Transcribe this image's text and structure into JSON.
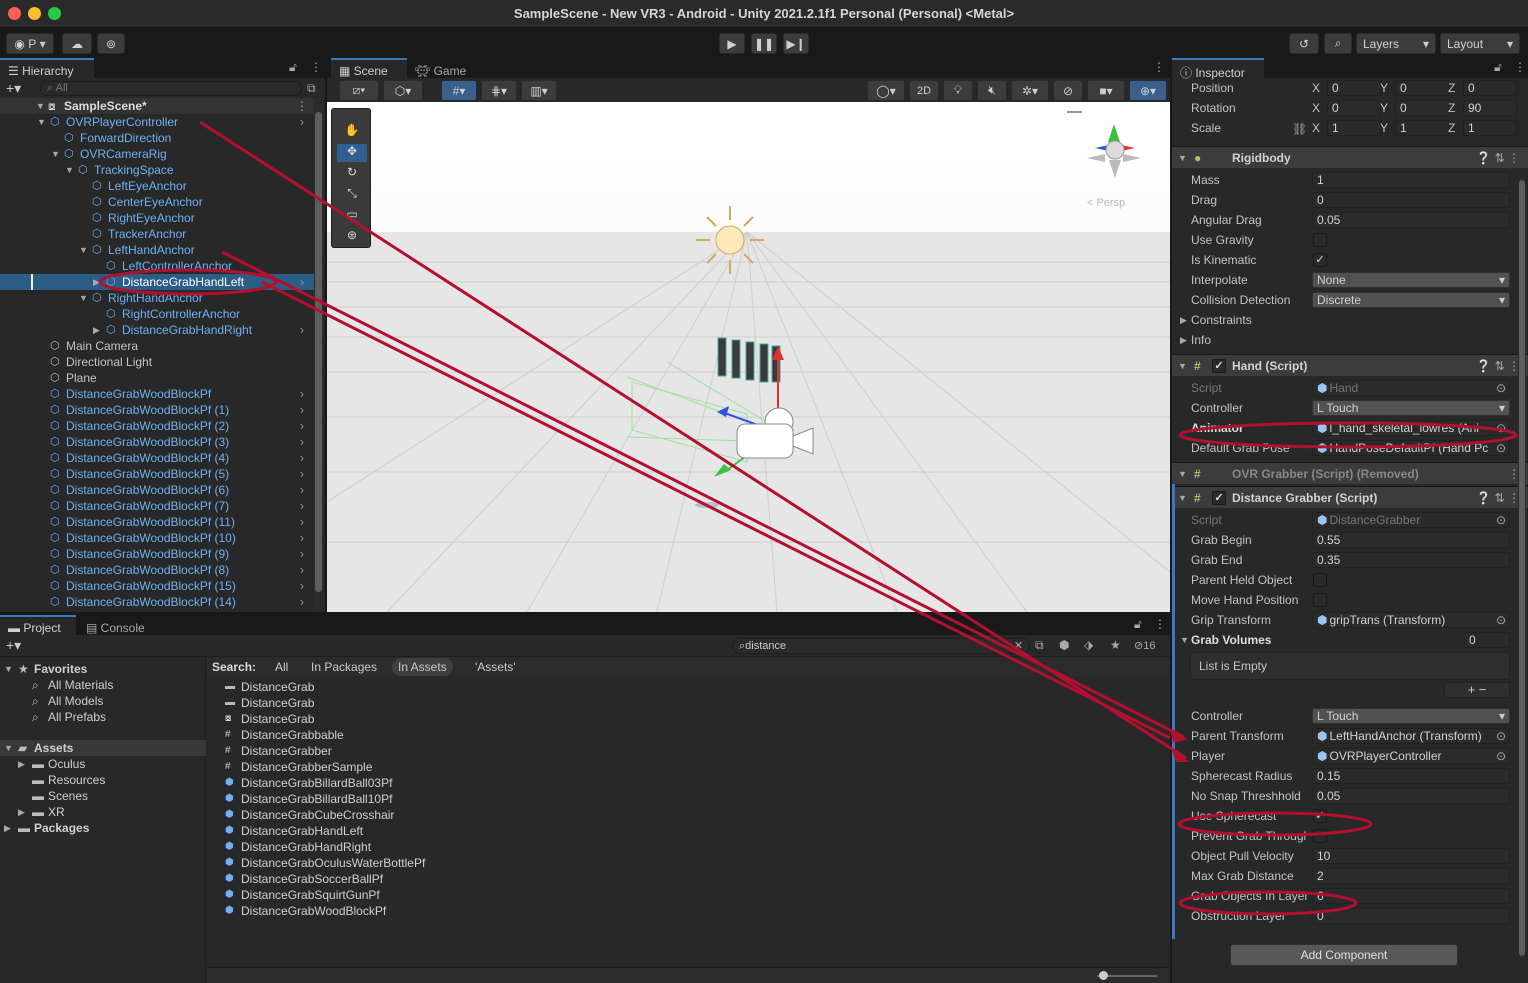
{
  "window": {
    "title": "SampleScene - New VR3 - Android - Unity 2021.2.1f1 Personal (Personal) <Metal>"
  },
  "toolbar": {
    "account": "P",
    "layers": "Layers",
    "layout": "Layout"
  },
  "hierarchy": {
    "tab": "Hierarchy",
    "search_placeholder": "All",
    "scene": "SampleScene*",
    "items": [
      {
        "label": "OVRPlayerController",
        "blue": true,
        "depth": 1,
        "fold": "open",
        "arrow": true
      },
      {
        "label": "ForwardDirection",
        "blue": true,
        "depth": 2
      },
      {
        "label": "OVRCameraRig",
        "blue": true,
        "depth": 2,
        "fold": "open"
      },
      {
        "label": "TrackingSpace",
        "blue": true,
        "depth": 3,
        "fold": "open"
      },
      {
        "label": "LeftEyeAnchor",
        "blue": true,
        "depth": 4
      },
      {
        "label": "CenterEyeAnchor",
        "blue": true,
        "depth": 4
      },
      {
        "label": "RightEyeAnchor",
        "blue": true,
        "depth": 4
      },
      {
        "label": "TrackerAnchor",
        "blue": true,
        "depth": 4
      },
      {
        "label": "LeftHandAnchor",
        "blue": true,
        "depth": 4,
        "fold": "open"
      },
      {
        "label": "LeftControllerAnchor",
        "blue": true,
        "depth": 5
      },
      {
        "label": "DistanceGrabHandLeft",
        "blue": true,
        "depth": 5,
        "fold": "closed",
        "selected": true,
        "arrow": true
      },
      {
        "label": "RightHandAnchor",
        "blue": true,
        "depth": 4,
        "fold": "open"
      },
      {
        "label": "RightControllerAnchor",
        "blue": true,
        "depth": 5
      },
      {
        "label": "DistanceGrabHandRight",
        "blue": true,
        "depth": 5,
        "fold": "closed",
        "arrow": true
      },
      {
        "label": "Main Camera",
        "blue": false,
        "depth": 1
      },
      {
        "label": "Directional Light",
        "blue": false,
        "depth": 1
      },
      {
        "label": "Plane",
        "blue": false,
        "depth": 1
      },
      {
        "label": "DistanceGrabWoodBlockPf",
        "blue": true,
        "depth": 1,
        "arrow": true
      },
      {
        "label": "DistanceGrabWoodBlockPf (1)",
        "blue": true,
        "depth": 1,
        "arrow": true
      },
      {
        "label": "DistanceGrabWoodBlockPf (2)",
        "blue": true,
        "depth": 1,
        "arrow": true
      },
      {
        "label": "DistanceGrabWoodBlockPf (3)",
        "blue": true,
        "depth": 1,
        "arrow": true
      },
      {
        "label": "DistanceGrabWoodBlockPf (4)",
        "blue": true,
        "depth": 1,
        "arrow": true
      },
      {
        "label": "DistanceGrabWoodBlockPf (5)",
        "blue": true,
        "depth": 1,
        "arrow": true
      },
      {
        "label": "DistanceGrabWoodBlockPf (6)",
        "blue": true,
        "depth": 1,
        "arrow": true
      },
      {
        "label": "DistanceGrabWoodBlockPf (7)",
        "blue": true,
        "depth": 1,
        "arrow": true
      },
      {
        "label": "DistanceGrabWoodBlockPf (11)",
        "blue": true,
        "depth": 1,
        "arrow": true
      },
      {
        "label": "DistanceGrabWoodBlockPf (10)",
        "blue": true,
        "depth": 1,
        "arrow": true
      },
      {
        "label": "DistanceGrabWoodBlockPf (9)",
        "blue": true,
        "depth": 1,
        "arrow": true
      },
      {
        "label": "DistanceGrabWoodBlockPf (8)",
        "blue": true,
        "depth": 1,
        "arrow": true
      },
      {
        "label": "DistanceGrabWoodBlockPf (15)",
        "blue": true,
        "depth": 1,
        "arrow": true
      },
      {
        "label": "DistanceGrabWoodBlockPf (14)",
        "blue": true,
        "depth": 1,
        "arrow": true
      }
    ]
  },
  "scene": {
    "tabs": [
      "Scene",
      "Game"
    ],
    "mode_2d": "2D",
    "persp": "< Persp"
  },
  "project": {
    "tabs": [
      "Project",
      "Console"
    ],
    "search_value": "distance",
    "hidden_count": "16",
    "search_label": "Search:",
    "filters": [
      "All",
      "In Packages",
      "In Assets",
      "'Assets'"
    ],
    "favorites": {
      "title": "Favorites",
      "items": [
        "All Materials",
        "All Models",
        "All Prefabs"
      ]
    },
    "assets_tree": {
      "title": "Assets",
      "items": [
        "Oculus",
        "Resources",
        "Scenes",
        "XR"
      ],
      "packages": "Packages"
    },
    "results": [
      {
        "name": "DistanceGrab",
        "icon": "folder"
      },
      {
        "name": "DistanceGrab",
        "icon": "folder"
      },
      {
        "name": "DistanceGrab",
        "icon": "scene"
      },
      {
        "name": "DistanceGrabbable",
        "icon": "script"
      },
      {
        "name": "DistanceGrabber",
        "icon": "script"
      },
      {
        "name": "DistanceGrabberSample",
        "icon": "script"
      },
      {
        "name": "DistanceGrabBillardBall03Pf",
        "icon": "prefab"
      },
      {
        "name": "DistanceGrabBillardBall10Pf",
        "icon": "prefab"
      },
      {
        "name": "DistanceGrabCubeCrosshair",
        "icon": "prefab"
      },
      {
        "name": "DistanceGrabHandLeft",
        "icon": "prefab"
      },
      {
        "name": "DistanceGrabHandRight",
        "icon": "prefab"
      },
      {
        "name": "DistanceGrabOculusWaterBottlePf",
        "icon": "prefab"
      },
      {
        "name": "DistanceGrabSoccerBallPf",
        "icon": "prefab"
      },
      {
        "name": "DistanceGrabSquirtGunPf",
        "icon": "prefab"
      },
      {
        "name": "DistanceGrabWoodBlockPf",
        "icon": "prefab"
      }
    ]
  },
  "inspector": {
    "tab": "Inspector",
    "transform": {
      "position": {
        "label": "Position",
        "x": "0",
        "y": "0",
        "z": "0"
      },
      "rotation": {
        "label": "Rotation",
        "x": "0",
        "y": "0",
        "z": "90"
      },
      "scale": {
        "label": "Scale",
        "x": "1",
        "y": "1",
        "z": "1"
      }
    },
    "rigidbody": {
      "title": "Rigidbody",
      "rows": [
        {
          "k": "Mass",
          "v": "1"
        },
        {
          "k": "Drag",
          "v": "0"
        },
        {
          "k": "Angular Drag",
          "v": "0.05"
        },
        {
          "k": "Use Gravity",
          "check": false
        },
        {
          "k": "Is Kinematic",
          "check": true
        },
        {
          "k": "Interpolate",
          "v": "None",
          "dropdown": true
        },
        {
          "k": "Collision Detection",
          "v": "Discrete",
          "dropdown": true
        },
        {
          "k": "Constraints",
          "fold": true
        },
        {
          "k": "Info",
          "fold": true
        }
      ]
    },
    "hand": {
      "title": "Hand (Script)",
      "rows": [
        {
          "k": "Script",
          "v": "Hand",
          "disabled": true,
          "obj": true
        },
        {
          "k": "Controller",
          "v": "L Touch",
          "dropdown": true
        },
        {
          "k": "Animator",
          "v": "l_hand_skeletal_lowres (Ani",
          "obj": true,
          "bold": true
        },
        {
          "k": "Default Grab Pose",
          "v": "HandPoseDefaultPf (Hand Pc",
          "obj": true
        }
      ]
    },
    "removed": {
      "title": "OVR Grabber (Script) (Removed)"
    },
    "grabber": {
      "title": "Distance Grabber (Script)",
      "rows": [
        {
          "k": "Script",
          "v": "DistanceGrabber",
          "disabled": true,
          "obj": true
        },
        {
          "k": "Grab Begin",
          "v": "0.55"
        },
        {
          "k": "Grab End",
          "v": "0.35"
        },
        {
          "k": "Parent Held Object",
          "check": false
        },
        {
          "k": "Move Hand Position",
          "check": false
        },
        {
          "k": "Grip Transform",
          "v": "gripTrans (Transform)",
          "obj": true
        }
      ],
      "grab_volumes": {
        "label": "Grab Volumes",
        "count": "0",
        "empty": "List is Empty"
      },
      "rows2": [
        {
          "k": "Controller",
          "v": "L Touch",
          "dropdown": true
        },
        {
          "k": "Parent Transform",
          "v": "LeftHandAnchor (Transform)",
          "obj": true
        },
        {
          "k": "Player",
          "v": "OVRPlayerController",
          "obj": true
        },
        {
          "k": "Spherecast Radius",
          "v": "0.15"
        },
        {
          "k": "No Snap Threshhold",
          "v": "0.05"
        },
        {
          "k": "Use Spherecast",
          "check": true
        },
        {
          "k": "Prevent Grab Througl",
          "check": false
        },
        {
          "k": "Object Pull Velocity",
          "v": "10"
        },
        {
          "k": "Max Grab Distance",
          "v": "2"
        },
        {
          "k": "Grab Objects In Layer",
          "v": "6"
        },
        {
          "k": "Obstruction Layer",
          "v": "0"
        }
      ]
    },
    "add_component": "Add Component"
  },
  "colors": {
    "accent": "#3a79bb",
    "annotation": "#b3102f",
    "prefab_blue": "#6fb1f5"
  }
}
